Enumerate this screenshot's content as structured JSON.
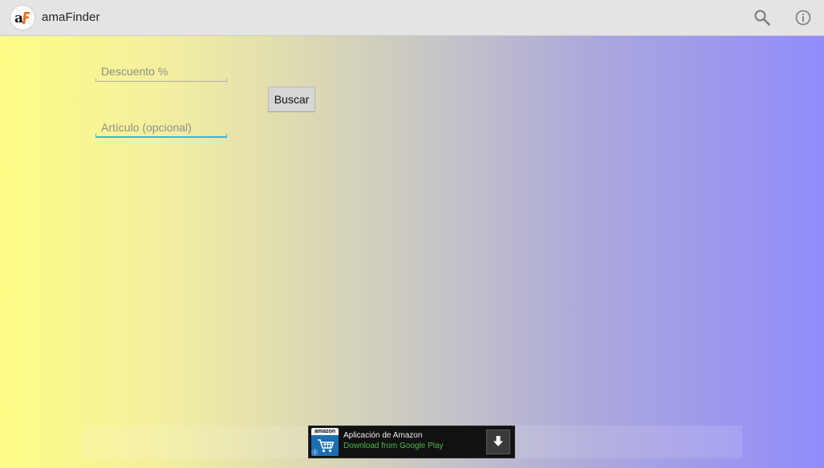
{
  "action_bar": {
    "title": "amaFinder",
    "logo_text": "aF",
    "actions": [
      "search-icon",
      "info-icon"
    ]
  },
  "form": {
    "discount_placeholder": "Descuento %",
    "discount_value": "",
    "article_placeholder": "Artículo (opcional)",
    "article_value": "",
    "search_button_label": "Buscar"
  },
  "ad": {
    "logo_word": "amazon",
    "title": "Aplicación de Amazon",
    "subtitle": "Download from Google Play",
    "download_icon": "download-arrow-icon",
    "info_badge": "i"
  },
  "colors": {
    "gradient_left": "#fefd85",
    "gradient_right": "#918cfb",
    "focus_accent": "#33b5e5",
    "ad_subtitle": "#4db849"
  }
}
